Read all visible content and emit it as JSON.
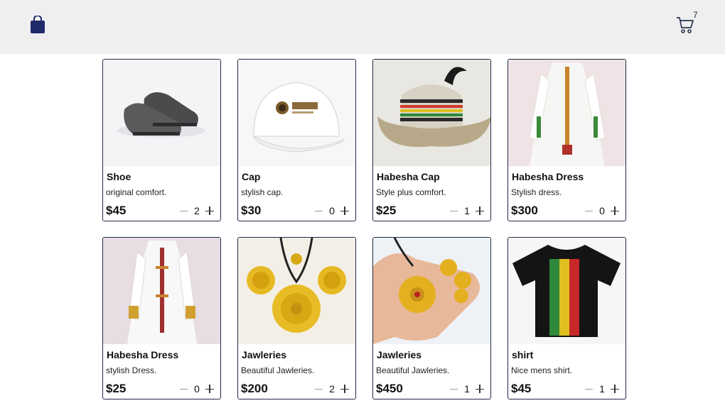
{
  "header": {
    "logo_icon": "shopping-bag-icon",
    "cart_icon": "cart-icon",
    "cart_count": "7",
    "colors": {
      "header_bg": "#f0eff0",
      "brand": "#1f2a6b"
    }
  },
  "products": [
    {
      "title": "Shoe",
      "description": "original comfort.",
      "price": "$45",
      "qty": "2",
      "image_icon": "shoe-image"
    },
    {
      "title": "Cap",
      "description": "stylish cap.",
      "price": "$30",
      "qty": "0",
      "image_icon": "cap-image"
    },
    {
      "title": "Habesha Cap",
      "description": "Style plus comfort.",
      "price": "$25",
      "qty": "1",
      "image_icon": "woven-hat-image"
    },
    {
      "title": "Habesha Dress",
      "description": "Stylish dress.",
      "price": "$300",
      "qty": "0",
      "image_icon": "dress-image"
    },
    {
      "title": "Habesha Dress",
      "description": "stylish Dress.",
      "price": "$25",
      "qty": "0",
      "image_icon": "dress-image"
    },
    {
      "title": "Jawleries",
      "description": "Beautiful Jawleries.",
      "price": "$200",
      "qty": "2",
      "image_icon": "jewelry-set-image"
    },
    {
      "title": "Jawleries",
      "description": "Beautiful Jawleries.",
      "price": "$450",
      "qty": "1",
      "image_icon": "jewelry-hand-image"
    },
    {
      "title": "shirt",
      "description": "Nice mens shirt.",
      "price": "$45",
      "qty": "1",
      "image_icon": "tshirt-image"
    }
  ]
}
